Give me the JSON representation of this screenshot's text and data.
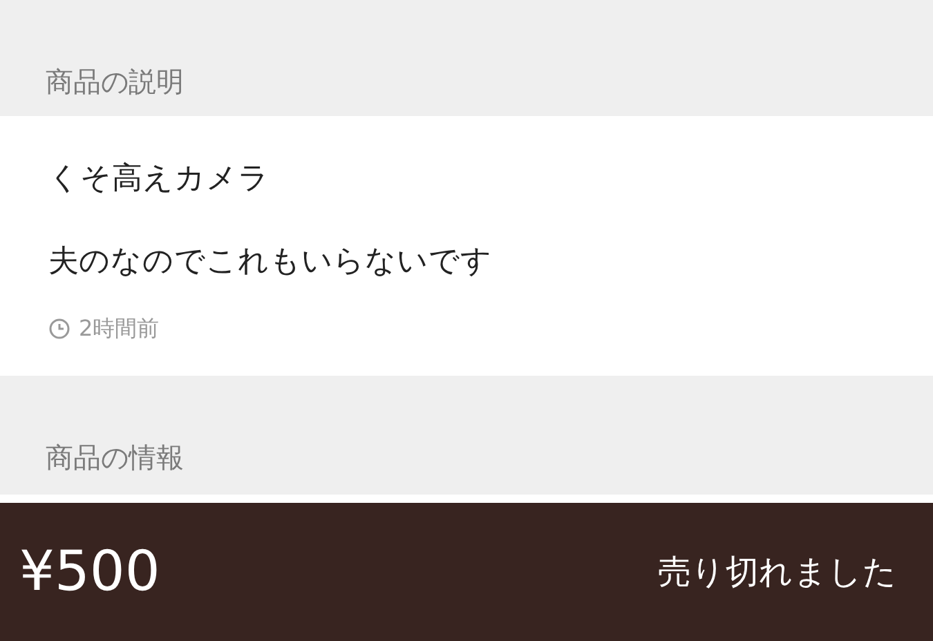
{
  "description_section": {
    "heading": "商品の説明",
    "lines": [
      "くそ高えカメラ",
      "夫のなのでこれもいらないです"
    ],
    "posted": "2時間前"
  },
  "info_section": {
    "heading": "商品の情報"
  },
  "bottom_bar": {
    "price": "¥500",
    "status": "売り切れました"
  }
}
